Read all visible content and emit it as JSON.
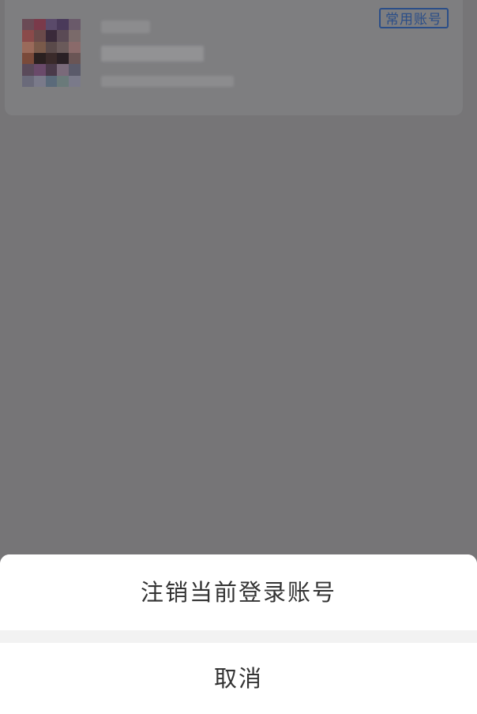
{
  "account": {
    "tag_label": "常用账号"
  },
  "action_sheet": {
    "logout_label": "注销当前登录账号",
    "cancel_label": "取消"
  },
  "colors": {
    "overlay": "#767577",
    "tag_accent": "#2b4e88",
    "sheet_background": "#ffffff",
    "sheet_divider": "#f2f2f2",
    "sheet_text": "#333333"
  }
}
